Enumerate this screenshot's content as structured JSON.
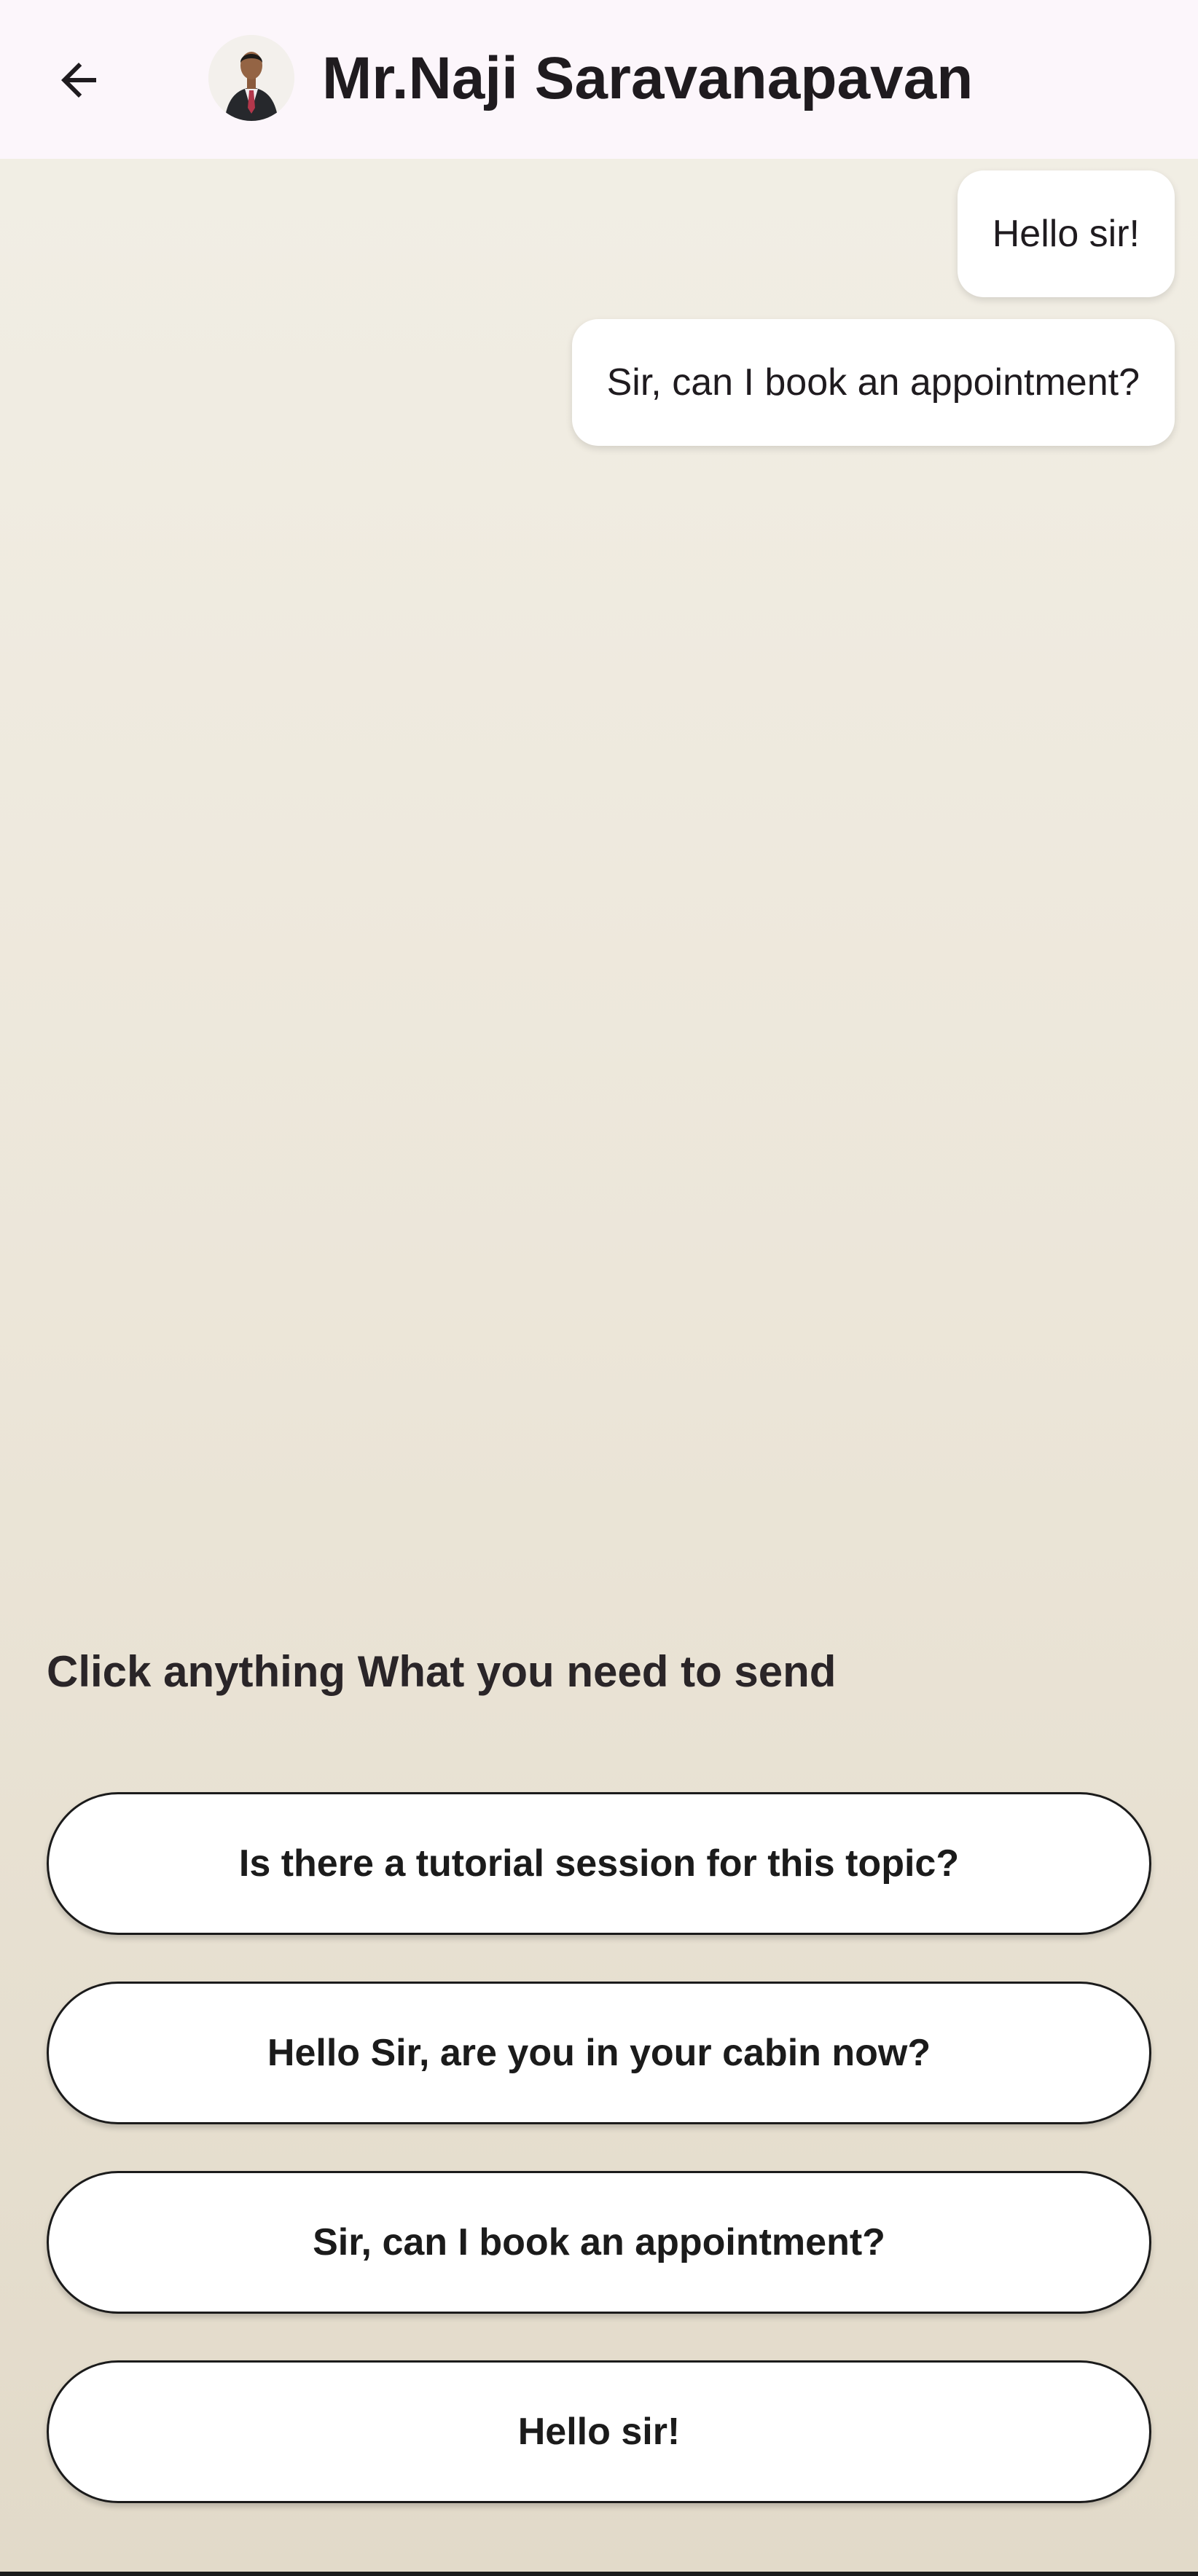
{
  "header": {
    "title": "Mr.Naji Saravanapavan",
    "back_icon": "arrow-left-icon",
    "avatar": "profile-photo"
  },
  "messages": [
    {
      "text": "Hello sir!",
      "sender": "me"
    },
    {
      "text": "Sir, can I book an appointment?",
      "sender": "me"
    }
  ],
  "quick_replies": {
    "heading": "Click anything What you need to send",
    "options": [
      "Is there a tutorial session for this topic?",
      "Hello Sir, are you in your cabin now?",
      "Sir, can I book an appointment?",
      "Hello sir!"
    ]
  },
  "colors": {
    "app_bar": "#fcf6fb",
    "background_top": "#f2efe6",
    "background_bottom": "#e2dac9",
    "bubble": "#ffffff",
    "button_border": "#1b1b1b"
  }
}
